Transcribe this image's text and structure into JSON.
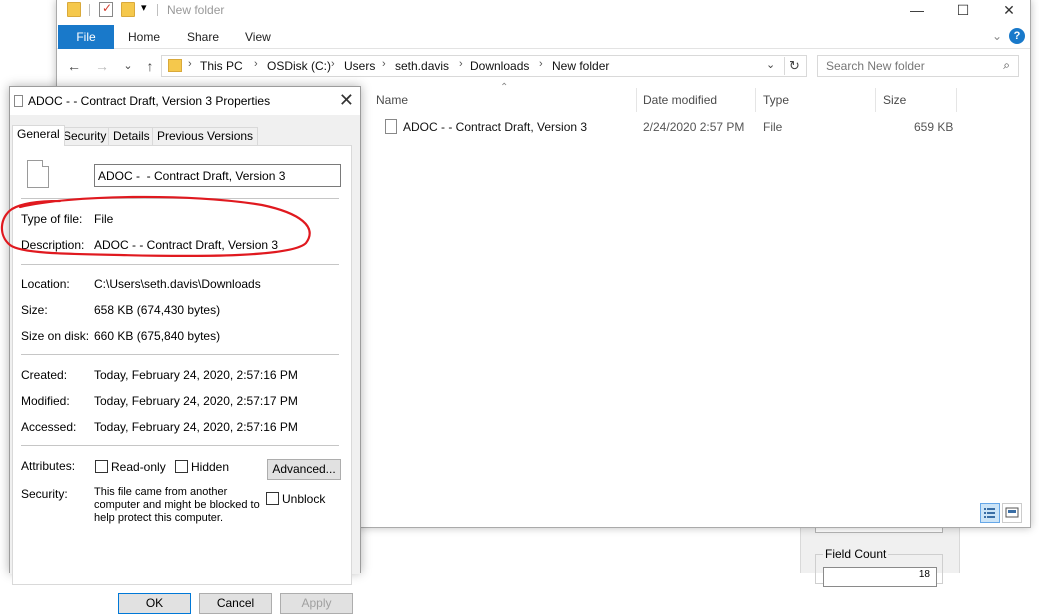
{
  "explorer": {
    "title": "New folder",
    "window_controls": {
      "minimize": "—",
      "maximize": "☐",
      "close": "✕"
    },
    "ribbon": {
      "tabs": [
        "File",
        "Home",
        "Share",
        "View"
      ],
      "expand_glyph": "⌄",
      "help_glyph": "?"
    },
    "nav": {
      "back": "←",
      "forward": "→",
      "recent": "⌄",
      "up": "↑",
      "refresh": "↻",
      "dropdown": "⌄"
    },
    "breadcrumb": [
      "This PC",
      "OSDisk (C:)",
      "Users",
      "seth.davis",
      "Downloads",
      "New folder"
    ],
    "breadcrumb_sep": "›",
    "search": {
      "placeholder": "Search New folder"
    },
    "columns": {
      "name": "Name",
      "date": "Date modified",
      "type": "Type",
      "size": "Size"
    },
    "sort_glyph": "⌃",
    "files": [
      {
        "name": "ADOC -  - Contract Draft, Version 3",
        "date": "2/24/2020 2:57 PM",
        "type": "File",
        "size": "659 KB"
      }
    ]
  },
  "properties": {
    "title": "ADOC -  - Contract Draft, Version 3 Properties",
    "close_glyph": "✕",
    "tabs": [
      "General",
      "Security",
      "Details",
      "Previous Versions"
    ],
    "name_value": "ADOC -  - Contract Draft, Version 3",
    "type_label": "Type of file:",
    "type_value": "File",
    "description_label": "Description:",
    "description_value": "ADOC -  - Contract Draft, Version 3",
    "location_label": "Location:",
    "location_value": "C:\\Users\\seth.davis\\Downloads",
    "size_label": "Size:",
    "size_value": "658 KB (674,430 bytes)",
    "size_on_disk_label": "Size on disk:",
    "size_on_disk_value": "660 KB (675,840 bytes)",
    "created_label": "Created:",
    "created_value": "Today, February 24, 2020, 2:57:16 PM",
    "modified_label": "Modified:",
    "modified_value": "Today, February 24, 2020, 2:57:17 PM",
    "accessed_label": "Accessed:",
    "accessed_value": "Today, February 24, 2020, 2:57:16 PM",
    "attributes_label": "Attributes:",
    "readonly_label": "Read-only",
    "hidden_label": "Hidden",
    "advanced_label": "Advanced...",
    "security_label": "Security:",
    "security_text": "This file came from another computer and might be blocked to help protect this computer.",
    "unblock_label": "Unblock",
    "ok_label": "OK",
    "cancel_label": "Cancel",
    "apply_label": "Apply"
  },
  "background_app": {
    "field_count_label": "Field Count",
    "field_count_value": "18"
  },
  "annotation_color": "#e0191f"
}
